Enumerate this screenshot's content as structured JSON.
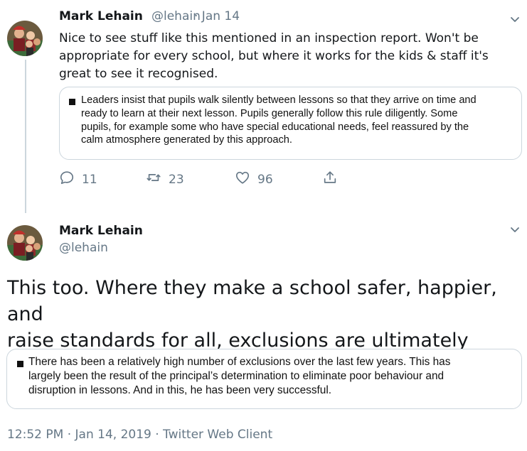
{
  "reply": {
    "author_name": "Mark Lehain",
    "author_handle": "@lehain",
    "date": "· Jan 14",
    "text": "Nice to see stuff like this mentioned in an inspection report. Won't be appropriate for every school, but where it works for the kids & staff it's great to see it recognised.",
    "quote_lines": [
      "Leaders insist that pupils walk silently between lessons so that they arrive on time and",
      "ready to learn at their next lesson. Pupils generally follow this rule diligently. Some",
      "pupils, for example some who have special educational needs, feel reassured by the",
      "calm atmosphere generated by this approach."
    ],
    "reply_count": "11",
    "retweet_count": "23",
    "like_count": "96",
    "icons": [
      "reply-icon",
      "retweet-icon",
      "like-icon",
      "share-icon",
      "chevron-down-icon"
    ]
  },
  "main": {
    "author_name": "Mark Lehain",
    "author_handle": "@lehain",
    "text_lines": [
      "This too. Where they make a school safer, happier, and",
      "raise standards for all, exclusions are ultimately inclusive."
    ],
    "quote_lines": [
      "There has been a relatively high number of exclusions over the last few years. This has",
      "largely been the result of the principal’s determination to eliminate poor behaviour and",
      "disruption in lessons. And in this, he has been very successful."
    ],
    "meta": "12:52 PM · Jan 14, 2019 · Twitter Web Client"
  }
}
